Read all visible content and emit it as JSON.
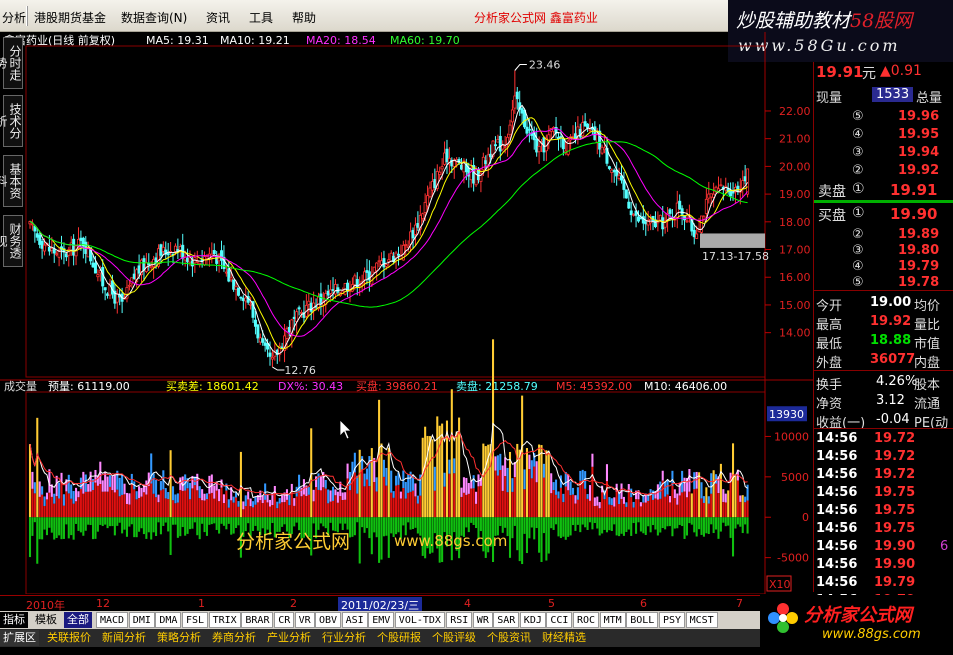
{
  "menu": {
    "items": [
      "分析",
      "港股期货基金",
      "数据查询(N)",
      "资讯",
      "工具",
      "帮助"
    ],
    "center_title": "分析家公式网  鑫富药业"
  },
  "banner": {
    "title_left": "炒股辅助教材",
    "title_right": "58股网",
    "url": "www.58Gu.com"
  },
  "left_tabs": [
    "分时走势",
    "技术分析",
    "基本资料",
    "财务透视"
  ],
  "price_header": {
    "name": "鑫富药业(日线 前复权)",
    "ma5": "MA5: 19.31",
    "ma10": "MA10: 19.21",
    "ma20": "MA20: 18.54",
    "ma60": "MA60: 19.70"
  },
  "price_annotations": {
    "high": "23.46",
    "low": "12.76",
    "range": "17.13-17.58"
  },
  "volume_header": {
    "label": "成交量",
    "forecast": "预量: 61119.00",
    "diff": "买卖差: 18601.42",
    "dx": "DX%: 30.43",
    "buy": "买盘: 39860.21",
    "sell": "卖盘: 21258.79",
    "m5": "M5: 45392.00",
    "m10": "M10: 46406.00"
  },
  "volume_watermark": {
    "cn": "分析家公式网",
    "url": "www.88gs.com"
  },
  "x10": "X10",
  "volume_right_tag": "13930",
  "chart_data": {
    "type": "candlestick",
    "price_axis": {
      "ticks": [
        14.0,
        15.0,
        16.0,
        17.0,
        18.0,
        19.0,
        20.0,
        21.0,
        22.0
      ],
      "ylim": [
        12.4,
        24.2
      ]
    },
    "volume_axis": {
      "ticks": [
        -5000,
        0,
        5000,
        10000
      ],
      "ylim": [
        -9500,
        15500
      ]
    },
    "x_labels": [
      "2010年",
      "12",
      "1",
      "2",
      "2011/02/23/三",
      "4",
      "5",
      "6",
      "7"
    ],
    "annotations": {
      "max": 23.46,
      "min": 12.76,
      "band": [
        17.13,
        17.58
      ]
    },
    "last_close": 19.91
  },
  "quote": {
    "price": "19.91",
    "price_unit": "元",
    "change": "▲0.91",
    "current_vol_label": "现量",
    "current_vol": "1533",
    "total_label": "总量",
    "ask_levels": [
      {
        "num": "⑤",
        "price": "19.96"
      },
      {
        "num": "④",
        "price": "19.95"
      },
      {
        "num": "③",
        "price": "19.94"
      },
      {
        "num": "②",
        "price": "19.92"
      }
    ],
    "ask1_label": "卖盘",
    "ask1_num": "①",
    "ask1_price": "19.91",
    "bid1_label": "买盘",
    "bid1_num": "①",
    "bid1_price": "19.90",
    "bid_levels": [
      {
        "num": "②",
        "price": "19.89"
      },
      {
        "num": "③",
        "price": "19.80"
      },
      {
        "num": "④",
        "price": "19.79"
      },
      {
        "num": "⑤",
        "price": "19.78"
      }
    ],
    "stats": [
      {
        "label": "今开",
        "value": "19.00",
        "label2": "均价",
        "color": "#ffffff"
      },
      {
        "label": "最高",
        "value": "19.92",
        "label2": "量比",
        "color": "#ff3030"
      },
      {
        "label": "最低",
        "value": "18.88",
        "label2": "市值",
        "color": "#00e000"
      },
      {
        "label": "外盘",
        "value": "36077",
        "label2": "内盘",
        "color": "#ff3030"
      }
    ],
    "stats2": [
      {
        "label": "换手",
        "value": "4.26%",
        "label2": "股本"
      },
      {
        "label": "净资",
        "value": "3.12",
        "label2": "流通"
      },
      {
        "label": "收益(一)",
        "value": "-0.04",
        "label2": "PE(动"
      }
    ],
    "ticks": [
      {
        "time": "14:56",
        "price": "19.72",
        "extra": ""
      },
      {
        "time": "14:56",
        "price": "19.72",
        "extra": ""
      },
      {
        "time": "14:56",
        "price": "19.72",
        "extra": ""
      },
      {
        "time": "14:56",
        "price": "19.75",
        "extra": ""
      },
      {
        "time": "14:56",
        "price": "19.75",
        "extra": ""
      },
      {
        "time": "14:56",
        "price": "19.75",
        "extra": ""
      },
      {
        "time": "14:56",
        "price": "19.90",
        "extra": "6"
      },
      {
        "time": "14:56",
        "price": "19.90",
        "extra": ""
      },
      {
        "time": "14:56",
        "price": "19.79",
        "extra": ""
      },
      {
        "time": "14:56",
        "price": "19.79",
        "extra": ""
      }
    ]
  },
  "tabs_row1": [
    "指标",
    "模板",
    "全部",
    "MACD",
    "DMI",
    "DMA",
    "FSL",
    "TRIX",
    "BRAR",
    "CR",
    "VR",
    "OBV",
    "ASI",
    "EMV",
    "VOL-TDX",
    "RSI",
    "WR",
    "SAR",
    "KDJ",
    "CCI",
    "ROC",
    "MTM",
    "BOLL",
    "PSY",
    "MCST"
  ],
  "tabs_row2": [
    "扩展区",
    "关联报价",
    "新闻分析",
    "策略分析",
    "券商分析",
    "产业分析",
    "行业分析",
    "个股研报",
    "个股评级",
    "个股资讯",
    "财经精选"
  ],
  "corner_logo": {
    "title": "分析家公式网",
    "url": "www.88gs.com"
  }
}
